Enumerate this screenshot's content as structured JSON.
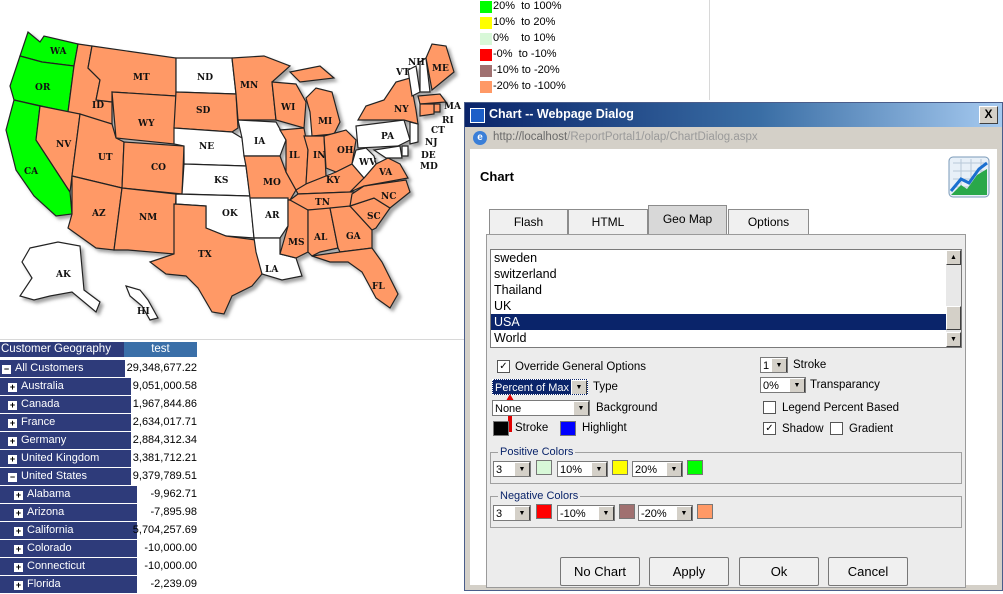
{
  "map": {
    "state_labels": [
      "WA",
      "OR",
      "CA",
      "ID",
      "NV",
      "MT",
      "WY",
      "UT",
      "AZ",
      "CO",
      "NM",
      "ND",
      "SD",
      "NE",
      "KS",
      "OK",
      "TX",
      "MN",
      "IA",
      "MO",
      "AR",
      "LA",
      "WI",
      "IL",
      "MS",
      "MI",
      "IN",
      "OH",
      "KY",
      "TN",
      "AL",
      "GA",
      "FL",
      "SC",
      "NC",
      "VA",
      "WV",
      "PA",
      "NY",
      "VT",
      "NH",
      "ME",
      "MA",
      "RI",
      "CT",
      "NJ",
      "DE",
      "MD",
      "AK",
      "HI"
    ],
    "colors": {
      "high": "#00ff00",
      "negative_high": "#ff9966",
      "none": "#ffffff"
    }
  },
  "legend": [
    {
      "color": "#00ff00",
      "label": "20%  to 100%"
    },
    {
      "color": "#ffff00",
      "label": "10%  to 20%"
    },
    {
      "color": "#d8f8d8",
      "label": "0%    to 10%"
    },
    {
      "color": "#ff0000",
      "label": "-0%  to -10%"
    },
    {
      "color": "#a07070",
      "label": "-10% to -20%"
    },
    {
      "color": "#ff9966",
      "label": "-20% to -100%"
    }
  ],
  "grid": {
    "header_dim": "Customer Geography",
    "header_measure": "test",
    "rows": [
      {
        "label": "All Customers",
        "value": "29,348,677.22",
        "level": 0,
        "toggle": "-"
      },
      {
        "label": "Australia",
        "value": "9,051,000.58",
        "level": 1,
        "toggle": "+"
      },
      {
        "label": "Canada",
        "value": "1,967,844.86",
        "level": 1,
        "toggle": "+"
      },
      {
        "label": "France",
        "value": "2,634,017.71",
        "level": 1,
        "toggle": "+"
      },
      {
        "label": "Germany",
        "value": "2,884,312.34",
        "level": 1,
        "toggle": "+"
      },
      {
        "label": "United Kingdom",
        "value": "3,381,712.21",
        "level": 1,
        "toggle": "+"
      },
      {
        "label": "United States",
        "value": "9,379,789.51",
        "level": 1,
        "toggle": "-"
      },
      {
        "label": "Alabama",
        "value": "-9,962.71",
        "level": 2,
        "toggle": "+"
      },
      {
        "label": "Arizona",
        "value": "-7,895.98",
        "level": 2,
        "toggle": "+"
      },
      {
        "label": "California",
        "value": "5,704,257.69",
        "level": 2,
        "toggle": "+"
      },
      {
        "label": "Colorado",
        "value": "-10,000.00",
        "level": 2,
        "toggle": "+"
      },
      {
        "label": "Connecticut",
        "value": "-10,000.00",
        "level": 2,
        "toggle": "+"
      },
      {
        "label": "Florida",
        "value": "-2,239.09",
        "level": 2,
        "toggle": "+"
      }
    ]
  },
  "dialog": {
    "title": "Chart -- Webpage Dialog",
    "url_host": "http://localhost",
    "url_path": "/ReportPortal1/olap/ChartDialog.aspx",
    "heading": "Chart",
    "close_label": "X",
    "tabs": [
      "Flash",
      "HTML",
      "Geo Map",
      "Options"
    ],
    "selected_tab": "Geo Map",
    "map_list": [
      "sweden",
      "switzerland",
      "Thailand",
      "UK",
      "USA",
      "World"
    ],
    "map_selected": "USA",
    "override_label": "Override General Options",
    "type_value": "Percent of Max",
    "type_label": "Type",
    "background_value": "None",
    "background_label": "Background",
    "stroke_label": "Stroke",
    "highlight_label": "Highlight",
    "stroke_width_value": "1",
    "stroke_width_label": "Stroke",
    "transparency_value": "0%",
    "transparency_label": "Transparancy",
    "legend_percent_label": "Legend Percent Based",
    "shadow_label": "Shadow",
    "gradient_label": "Gradient",
    "positive_colors_label": "Positive Colors",
    "positive_count": "3",
    "positive_t1": "10%",
    "positive_t2": "20%",
    "negative_colors_label": "Negative Colors",
    "negative_count": "3",
    "negative_t1": "-10%",
    "negative_t2": "-20%",
    "buttons": {
      "no_chart": "No Chart",
      "apply": "Apply",
      "ok": "Ok",
      "cancel": "Cancel"
    }
  }
}
